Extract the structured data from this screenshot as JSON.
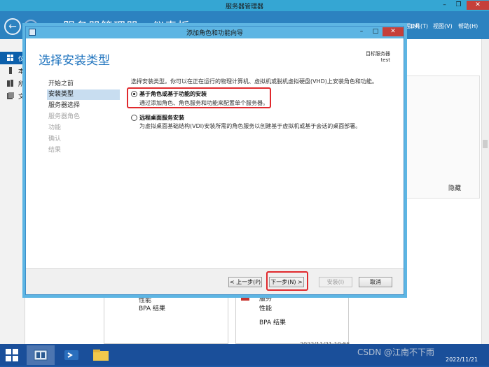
{
  "server_manager": {
    "title": "服务器管理器",
    "breadcrumb": "服务器管理器 · 仪表板",
    "menu": {
      "manage": "管理(M)",
      "tools": "工具(T)",
      "view": "视图(V)",
      "help": "帮助(H)"
    },
    "nav": [
      {
        "label": "仪",
        "icon": "dashboard-icon"
      },
      {
        "label": "本",
        "icon": "server-icon"
      },
      {
        "label": "所",
        "icon": "servers-icon"
      },
      {
        "label": "文",
        "icon": "file-icon"
      }
    ],
    "hide_label": "隐藏",
    "tiles": {
      "left": {
        "performance": "性能",
        "bpa": "BPA 结果"
      },
      "right": {
        "badge": "1",
        "services": "服务",
        "performance": "性能",
        "bpa": "BPA 结果"
      }
    },
    "timestamp": "2022/11/21 10:55"
  },
  "wizard": {
    "title": "添加角色和功能向导",
    "heading": "选择安装类型",
    "destination_label": "目标服务器",
    "destination_value": "test",
    "steps": [
      {
        "label": "开始之前",
        "state": "done"
      },
      {
        "label": "安装类型",
        "state": "active"
      },
      {
        "label": "服务器选择",
        "state": "done"
      },
      {
        "label": "服务器角色",
        "state": "disabled"
      },
      {
        "label": "功能",
        "state": "disabled"
      },
      {
        "label": "确认",
        "state": "disabled"
      },
      {
        "label": "结果",
        "state": "disabled"
      }
    ],
    "description": "选择安装类型。你可以在正在运行的物理计算机、虚拟机或脱机虚拟硬盘(VHD)上安装角色和功能。",
    "options": [
      {
        "title": "基于角色或基于功能的安装",
        "desc": "通过添加角色、角色服务和功能来配置单个服务器。",
        "selected": true
      },
      {
        "title": "远程桌面服务安装",
        "desc": "为虚拟桌面基础结构(VDI)安装所需的角色服务以创建基于虚拟机或基于会话的桌面部署。",
        "selected": false
      }
    ],
    "buttons": {
      "previous": "< 上一步(P)",
      "next": "下一步(N) >",
      "install": "安装(I)",
      "cancel": "取消"
    }
  },
  "taskbar": {
    "apps": [
      {
        "icon": "server-manager-icon"
      },
      {
        "icon": "powershell-icon"
      },
      {
        "icon": "file-explorer-icon"
      }
    ],
    "date": "2022/11/21"
  },
  "watermark": "CSDN @江南不下雨"
}
